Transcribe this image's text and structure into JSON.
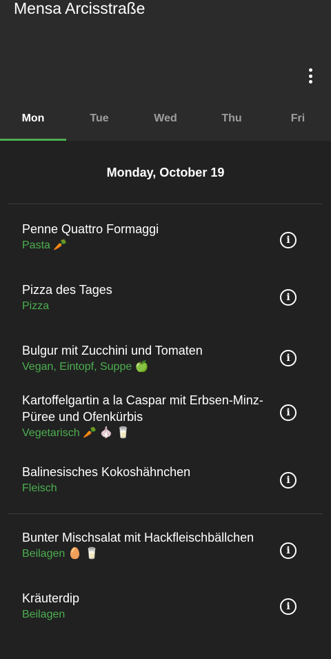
{
  "app": {
    "title": "Mensa Arcisstraße"
  },
  "tabs": [
    {
      "label": "Mon"
    },
    {
      "label": "Tue"
    },
    {
      "label": "Wed"
    },
    {
      "label": "Thu"
    },
    {
      "label": "Fri"
    }
  ],
  "date_header": "Monday, October 19",
  "groups": [
    {
      "meals": [
        {
          "name": "Penne Quattro Formaggi",
          "category": "Pasta 🥕"
        },
        {
          "name": "Pizza des Tages",
          "category": "Pizza"
        },
        {
          "name": "Bulgur mit Zucchini und Tomaten",
          "category": "Vegan, Eintopf, Suppe 🍏"
        },
        {
          "name": "Kartoffelgartin a la Caspar mit Erbsen-Minz-Püree und Ofenkürbis",
          "category": "Vegetarisch 🥕 🧄 🥛"
        },
        {
          "name": "Balinesisches Kokoshähnchen",
          "category": "Fleisch"
        }
      ]
    },
    {
      "meals": [
        {
          "name": "Bunter Mischsalat mit Hackfleischbällchen",
          "category": "Beilagen 🥚 🥛"
        },
        {
          "name": "Kräuterdip",
          "category": "Beilagen"
        }
      ]
    }
  ],
  "colors": {
    "accent": "#4caf50",
    "background": "#212121",
    "toolbar": "#2b2b2b"
  },
  "icons": {
    "overflow": "more-vert-icon",
    "info": "info-icon"
  }
}
